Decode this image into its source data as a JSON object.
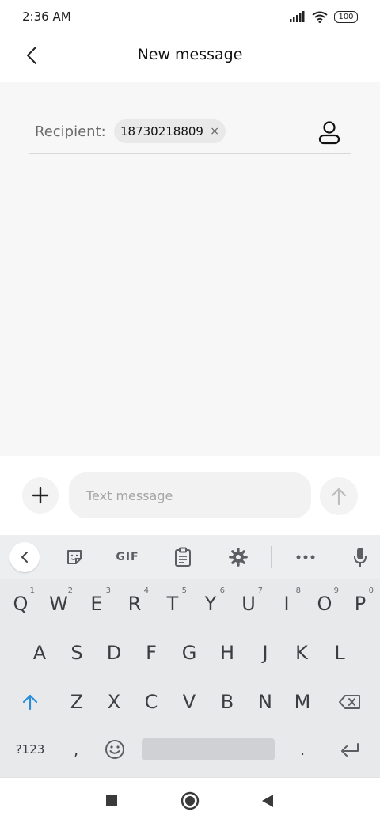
{
  "status_bar": {
    "time": "2:36 AM",
    "battery": "100"
  },
  "header": {
    "title": "New message"
  },
  "recipient": {
    "label": "Recipient:",
    "number": "18730218809",
    "remove": "×"
  },
  "composer": {
    "placeholder": "Text message"
  },
  "keyboard": {
    "toolbar": {
      "gif": "GIF"
    },
    "row1": [
      {
        "key": "Q",
        "hint": "1"
      },
      {
        "key": "W",
        "hint": "2"
      },
      {
        "key": "E",
        "hint": "3"
      },
      {
        "key": "R",
        "hint": "4"
      },
      {
        "key": "T",
        "hint": "5"
      },
      {
        "key": "Y",
        "hint": "6"
      },
      {
        "key": "U",
        "hint": "7"
      },
      {
        "key": "I",
        "hint": "8"
      },
      {
        "key": "O",
        "hint": "9"
      },
      {
        "key": "P",
        "hint": "0"
      }
    ],
    "row2": [
      "A",
      "S",
      "D",
      "F",
      "G",
      "H",
      "J",
      "K",
      "L"
    ],
    "row3": [
      "Z",
      "X",
      "C",
      "V",
      "B",
      "N",
      "M"
    ],
    "row4": {
      "symbols": "?123",
      "comma": ",",
      "period": "."
    }
  },
  "colors": {
    "accent": "#2a8fd8",
    "conversation_bg": "#f7f7f7",
    "keyboard_bg": "#e8e9eb"
  }
}
